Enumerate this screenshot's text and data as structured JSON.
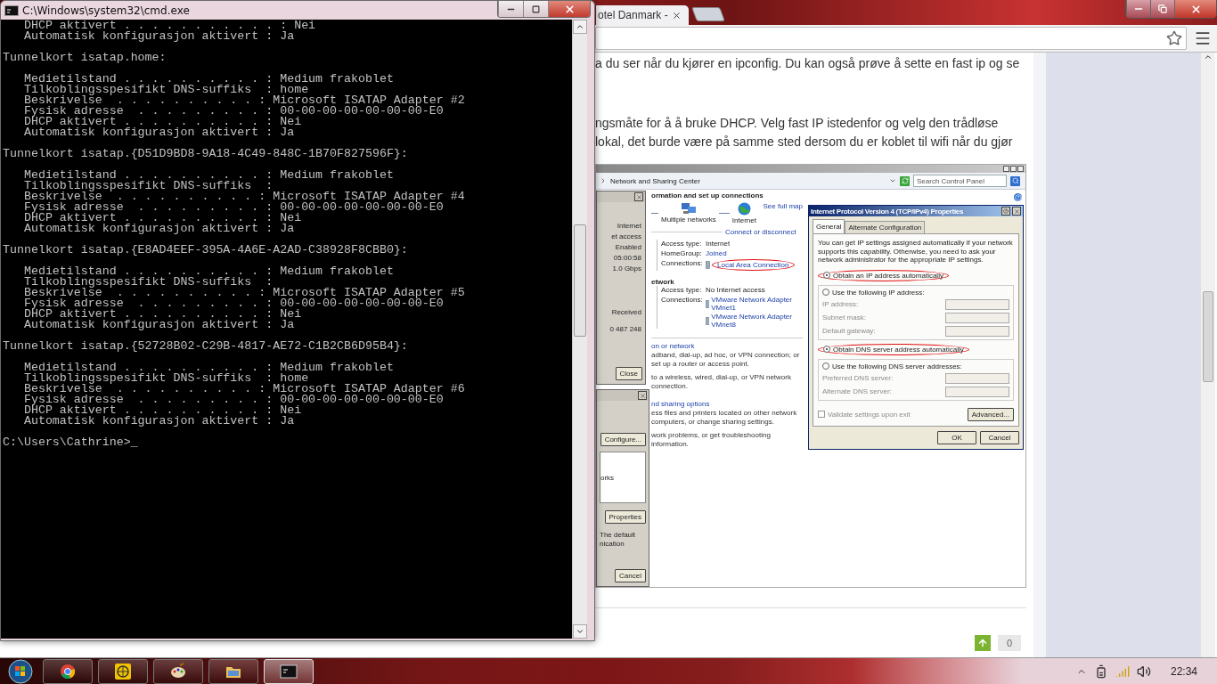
{
  "cmd": {
    "title": "C:\\Windows\\system32\\cmd.exe",
    "blocks": [
      {
        "lines": [
          "   DHCP aktivert . . . . . . . . . . . : Nei",
          "   Automatisk konfigurasjon aktivert : Ja"
        ]
      },
      {
        "heading": "Tunnelkort isatap.home:",
        "lines": [
          "   Medietilstand . . . . . . . . . . : Medium frakoblet",
          "   Tilkoblingsspesifikt DNS-suffiks  : home",
          "   Beskrivelse  . . . . . . . . . . : Microsoft ISATAP Adapter #2",
          "   Fysisk adresse  . . . . . . . . . : 00-00-00-00-00-00-00-E0",
          "   DHCP aktivert . . . . . . . . . . : Nei",
          "   Automatisk konfigurasjon aktivert : Ja"
        ]
      },
      {
        "heading": "Tunnelkort isatap.{D51D9BD8-9A18-4C49-848C-1B70F827596F}:",
        "lines": [
          "   Medietilstand . . . . . . . . . . : Medium frakoblet",
          "   Tilkoblingsspesifikt DNS-suffiks  :",
          "   Beskrivelse  . . . . . . . . . . : Microsoft ISATAP Adapter #4",
          "   Fysisk adresse  . . . . . . . . . : 00-00-00-00-00-00-00-E0",
          "   DHCP aktivert . . . . . . . . . . : Nei",
          "   Automatisk konfigurasjon aktivert : Ja"
        ]
      },
      {
        "heading": "Tunnelkort isatap.{E8AD4EEF-395A-4A6E-A2AD-C38928F8CBB0}:",
        "lines": [
          "   Medietilstand . . . . . . . . . . : Medium frakoblet",
          "   Tilkoblingsspesifikt DNS-suffiks  :",
          "   Beskrivelse  . . . . . . . . . . : Microsoft ISATAP Adapter #5",
          "   Fysisk adresse  . . . . . . . . . : 00-00-00-00-00-00-00-E0",
          "   DHCP aktivert . . . . . . . . . . : Nei",
          "   Automatisk konfigurasjon aktivert : Ja"
        ]
      },
      {
        "heading": "Tunnelkort isatap.{52728B02-C29B-4817-AE72-C1B2CB6D95B4}:",
        "lines": [
          "   Medietilstand . . . . . . . . . . : Medium frakoblet",
          "   Tilkoblingsspesifikt DNS-suffiks  : home",
          "   Beskrivelse  . . . . . . . . . . : Microsoft ISATAP Adapter #6",
          "   Fysisk adresse  . . . . . . . . . : 00-00-00-00-00-00-00-E0",
          "   DHCP aktivert . . . . . . . . . . : Nei",
          "   Automatisk konfigurasjon aktivert : Ja"
        ]
      }
    ],
    "prompt": "C:\\Users\\Cathrine>",
    "cursor": "_"
  },
  "browser": {
    "tab": {
      "title": "otel Danmark -"
    },
    "paragraphs": [
      {
        "lines": [
          "a du ser når du kjører en ipconfig. Du kan også prøve å sette en fast ip og se"
        ]
      },
      {
        "lines": [
          "ngsmåte for å å bruke DHCP. Velg fast IP istedenfor og velg den trådløse",
          "lokal, det burde være på samme sted dersom du er koblet til wifi når du gjør"
        ]
      }
    ],
    "screenshot": {
      "address": "Network and Sharing Center",
      "search_placeholder": "Search Control Panel",
      "status_dialog": {
        "values": [
          "Internet",
          "et access",
          "Enabled",
          "05:00:58",
          "1.0 Gbps"
        ],
        "received": "Received",
        "bytes": "0 487 248",
        "close": "Close"
      },
      "properties_dialog": {
        "configure": "Configure...",
        "list_item": "orks",
        "properties": "Properties",
        "description": "The default\nnication",
        "cancel": "Cancel"
      },
      "heading": "ormation and set up connections",
      "map_nodes": [
        {
          "kind": "networks",
          "label": "Multiple networks"
        },
        {
          "kind": "internet",
          "label": "Internet"
        }
      ],
      "see_full_map": "See full map",
      "connect_link": "Connect or disconnect",
      "networks": [
        {
          "rows": [
            {
              "label": "Access type:",
              "values": [
                {
                  "kind": "text",
                  "text": "Internet",
                  "circled": false
                }
              ]
            },
            {
              "label": "HomeGroup:",
              "values": [
                {
                  "kind": "link",
                  "text": "Joined",
                  "circled": false
                }
              ]
            },
            {
              "label": "Connections:",
              "values": [
                {
                  "kind": "adapter",
                  "text": "Local Area Connection",
                  "circled": true
                }
              ]
            }
          ]
        },
        {
          "name": "etwork",
          "rows": [
            {
              "label": "Access type:",
              "values": [
                {
                  "kind": "text",
                  "text": "No Internet access",
                  "circled": false
                }
              ]
            },
            {
              "label": "Connections:",
              "values": [
                {
                  "kind": "adapter",
                  "text": "VMware Network Adapter VMnet1",
                  "circled": false
                },
                {
                  "kind": "adapter",
                  "text": "VMware Network Adapter VMnet8",
                  "circled": false
                }
              ]
            }
          ]
        }
      ],
      "tasks": [
        {
          "link": "on or network",
          "desc": "adband, dial-up, ad hoc, or VPN connection; or set up a router or access point."
        },
        {
          "desc": "to a wireless, wired, dial-up, or VPN network connection."
        },
        {
          "link": "nd sharing options",
          "desc": "ess files and printers located on other network computers, or change sharing settings."
        },
        {
          "desc": "work problems, or get troubleshooting information."
        }
      ],
      "ipv4": {
        "title": "Internet Protocol Version 4 (TCP/IPv4) Properties",
        "tabs": [
          {
            "label": "General",
            "selected": true
          },
          {
            "label": "Alternate Configuration",
            "selected": false
          }
        ],
        "intro": "You can get IP settings assigned automatically if your network supports this capability. Otherwise, you need to ask your network administrator for the appropriate IP settings.",
        "groups": [
          {
            "options": [
              {
                "label": "Obtain an IP address automatically",
                "selected": true,
                "circled": true
              },
              {
                "label": "Use the following IP address:",
                "selected": false,
                "circled": false
              }
            ],
            "fields": [
              "IP address:",
              "Subnet mask:",
              "Default gateway:"
            ]
          },
          {
            "options": [
              {
                "label": "Obtain DNS server address automatically",
                "selected": true,
                "circled": true
              },
              {
                "label": "Use the following DNS server addresses:",
                "selected": false,
                "circled": false
              }
            ],
            "fields": [
              "Preferred DNS server:",
              "Alternate DNS server:"
            ]
          }
        ],
        "validate": {
          "label": "Validate settings upon exit",
          "checked": false
        },
        "advanced": "Advanced...",
        "buttons": [
          "OK",
          "Cancel"
        ]
      }
    },
    "vote_count": "0"
  },
  "taskbar": {
    "apps": [
      {
        "kind": "chrome",
        "active": false
      },
      {
        "kind": "globe",
        "active": false
      },
      {
        "kind": "paint",
        "active": false
      },
      {
        "kind": "folder",
        "active": false
      },
      {
        "kind": "console",
        "active": true
      }
    ],
    "clock": "22:34"
  }
}
